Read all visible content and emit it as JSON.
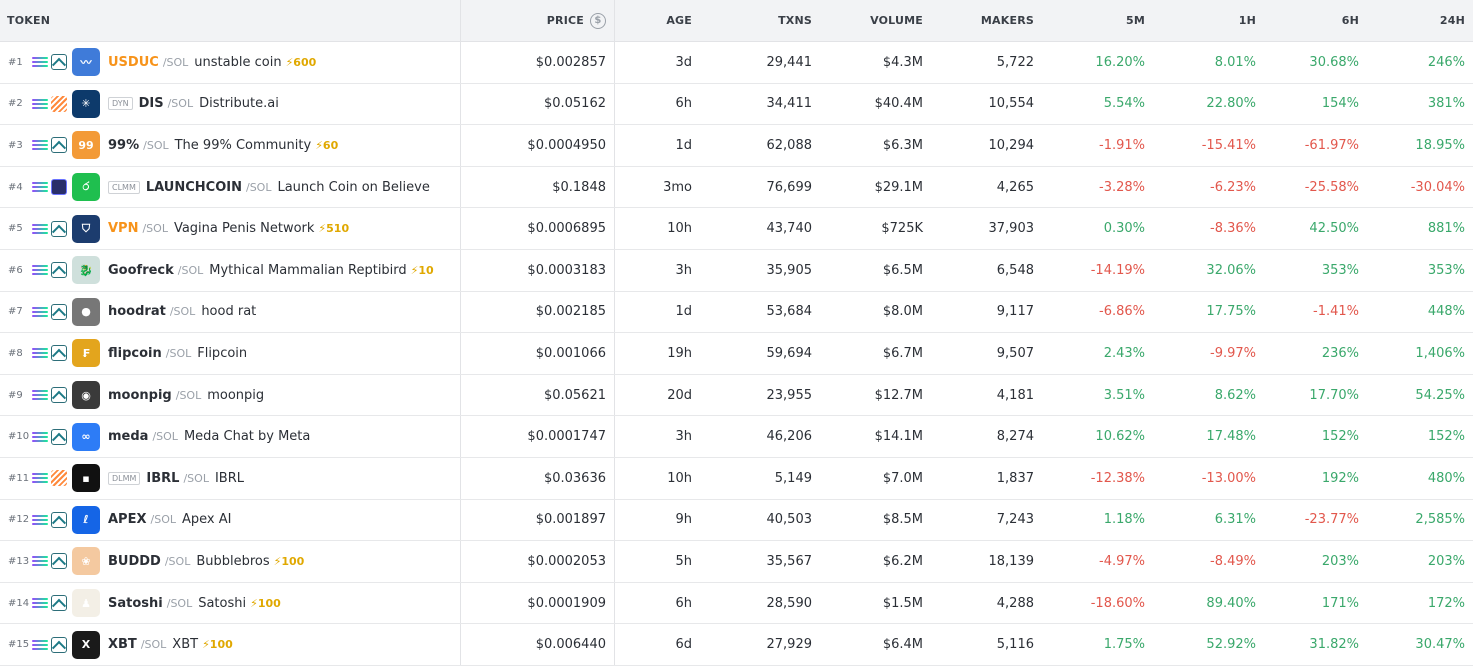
{
  "headers": {
    "token": "TOKEN",
    "price": "PRICE",
    "age": "AGE",
    "txns": "TXNS",
    "volume": "VOLUME",
    "makers": "MAKERS",
    "m5": "5M",
    "h1": "1H",
    "h6": "6H",
    "h24": "24H"
  },
  "rows": [
    {
      "rank": "#1",
      "badge": "",
      "symbol": "USDUC",
      "pair": "/SOL",
      "name": "unstable coin",
      "boost": "600",
      "price": "$0.002857",
      "age": "3d",
      "txns": "29,441",
      "volume": "$4.3M",
      "makers": "5,722",
      "m5": "16.20%",
      "h1": "8.01%",
      "h6": "30.68%",
      "h24": "246%",
      "dex": "ray",
      "logo_color": "#3f7bd9",
      "logo_glyph": "〰",
      "sym_color": "orange",
      "signs": [
        "pos",
        "pos",
        "pos",
        "pos"
      ]
    },
    {
      "rank": "#2",
      "badge": "DYN",
      "symbol": "DIS",
      "pair": "/SOL",
      "name": "Distribute.ai",
      "boost": "",
      "price": "$0.05162",
      "age": "6h",
      "txns": "34,411",
      "volume": "$40.4M",
      "makers": "10,554",
      "m5": "5.54%",
      "h1": "22.80%",
      "h6": "154%",
      "h24": "381%",
      "dex": "stripe",
      "logo_color": "#0d3a6b",
      "logo_glyph": "✳",
      "sym_color": "",
      "signs": [
        "pos",
        "pos",
        "pos",
        "pos"
      ]
    },
    {
      "rank": "#3",
      "badge": "",
      "symbol": "99%",
      "pair": "/SOL",
      "name": "The 99% Community",
      "boost": "60",
      "price": "$0.0004950",
      "age": "1d",
      "txns": "62,088",
      "volume": "$6.3M",
      "makers": "10,294",
      "m5": "-1.91%",
      "h1": "-15.41%",
      "h6": "-61.97%",
      "h24": "18.95%",
      "dex": "ray",
      "logo_color": "#f39a37",
      "logo_glyph": "99",
      "sym_color": "",
      "signs": [
        "neg",
        "neg",
        "neg",
        "pos"
      ]
    },
    {
      "rank": "#4",
      "badge": "CLMM",
      "symbol": "LAUNCHCOIN",
      "pair": "/SOL",
      "name": "Launch Coin on Believe",
      "boost": "",
      "price": "$0.1848",
      "age": "3mo",
      "txns": "76,699",
      "volume": "$29.1M",
      "makers": "4,265",
      "m5": "-3.28%",
      "h1": "-6.23%",
      "h6": "-25.58%",
      "h24": "-30.04%",
      "dex": "blk",
      "logo_color": "#1fbf4f",
      "logo_glyph": "ර",
      "sym_color": "",
      "signs": [
        "neg",
        "neg",
        "neg",
        "neg"
      ]
    },
    {
      "rank": "#5",
      "badge": "",
      "symbol": "VPN",
      "pair": "/SOL",
      "name": "Vagina Penis Network",
      "boost": "510",
      "price": "$0.0006895",
      "age": "10h",
      "txns": "43,740",
      "volume": "$725K",
      "makers": "37,903",
      "m5": "0.30%",
      "h1": "-8.36%",
      "h6": "42.50%",
      "h24": "881%",
      "dex": "ray",
      "logo_color": "#1c3c6e",
      "logo_glyph": "⛉",
      "sym_color": "orange",
      "signs": [
        "pos",
        "neg",
        "pos",
        "pos"
      ]
    },
    {
      "rank": "#6",
      "badge": "",
      "symbol": "Goofreck",
      "pair": "/SOL",
      "name": "Mythical Mammalian Reptibird",
      "boost": "10",
      "price": "$0.0003183",
      "age": "3h",
      "txns": "35,905",
      "volume": "$6.5M",
      "makers": "6,548",
      "m5": "-14.19%",
      "h1": "32.06%",
      "h6": "353%",
      "h24": "353%",
      "dex": "ray",
      "logo_color": "#cfe0dc",
      "logo_glyph": "🐉",
      "sym_color": "",
      "signs": [
        "neg",
        "pos",
        "pos",
        "pos"
      ]
    },
    {
      "rank": "#7",
      "badge": "",
      "symbol": "hoodrat",
      "pair": "/SOL",
      "name": "hood rat",
      "boost": "",
      "price": "$0.002185",
      "age": "1d",
      "txns": "53,684",
      "volume": "$8.0M",
      "makers": "9,117",
      "m5": "-6.86%",
      "h1": "17.75%",
      "h6": "-1.41%",
      "h24": "448%",
      "dex": "ray",
      "logo_color": "#777777",
      "logo_glyph": "●",
      "sym_color": "",
      "signs": [
        "neg",
        "pos",
        "neg",
        "pos"
      ]
    },
    {
      "rank": "#8",
      "badge": "",
      "symbol": "flipcoin",
      "pair": "/SOL",
      "name": "Flipcoin",
      "boost": "",
      "price": "$0.001066",
      "age": "19h",
      "txns": "59,694",
      "volume": "$6.7M",
      "makers": "9,507",
      "m5": "2.43%",
      "h1": "-9.97%",
      "h6": "236%",
      "h24": "1,406%",
      "dex": "ray",
      "logo_color": "#e3a51d",
      "logo_glyph": "₣",
      "sym_color": "",
      "signs": [
        "pos",
        "neg",
        "pos",
        "pos"
      ]
    },
    {
      "rank": "#9",
      "badge": "",
      "symbol": "moonpig",
      "pair": "/SOL",
      "name": "moonpig",
      "boost": "",
      "price": "$0.05621",
      "age": "20d",
      "txns": "23,955",
      "volume": "$12.7M",
      "makers": "4,181",
      "m5": "3.51%",
      "h1": "8.62%",
      "h6": "17.70%",
      "h24": "54.25%",
      "dex": "ray",
      "logo_color": "#3a3a3a",
      "logo_glyph": "◉",
      "sym_color": "",
      "signs": [
        "pos",
        "pos",
        "pos",
        "pos"
      ]
    },
    {
      "rank": "#10",
      "badge": "",
      "symbol": "meda",
      "pair": "/SOL",
      "name": "Meda Chat by Meta",
      "boost": "",
      "price": "$0.0001747",
      "age": "3h",
      "txns": "46,206",
      "volume": "$14.1M",
      "makers": "8,274",
      "m5": "10.62%",
      "h1": "17.48%",
      "h6": "152%",
      "h24": "152%",
      "dex": "ray",
      "logo_color": "#2d7cf6",
      "logo_glyph": "∞",
      "sym_color": "",
      "signs": [
        "pos",
        "pos",
        "pos",
        "pos"
      ]
    },
    {
      "rank": "#11",
      "badge": "DLMM",
      "symbol": "IBRL",
      "pair": "/SOL",
      "name": "IBRL",
      "boost": "",
      "price": "$0.03636",
      "age": "10h",
      "txns": "5,149",
      "volume": "$7.0M",
      "makers": "1,837",
      "m5": "-12.38%",
      "h1": "-13.00%",
      "h6": "192%",
      "h24": "480%",
      "dex": "stripe",
      "logo_color": "#111111",
      "logo_glyph": "▪",
      "sym_color": "",
      "signs": [
        "neg",
        "neg",
        "pos",
        "pos"
      ]
    },
    {
      "rank": "#12",
      "badge": "",
      "symbol": "APEX",
      "pair": "/SOL",
      "name": "Apex AI",
      "boost": "",
      "price": "$0.001897",
      "age": "9h",
      "txns": "40,503",
      "volume": "$8.5M",
      "makers": "7,243",
      "m5": "1.18%",
      "h1": "6.31%",
      "h6": "-23.77%",
      "h24": "2,585%",
      "dex": "ray",
      "logo_color": "#1565e6",
      "logo_glyph": "ℓ",
      "sym_color": "",
      "signs": [
        "pos",
        "pos",
        "neg",
        "pos"
      ]
    },
    {
      "rank": "#13",
      "badge": "",
      "symbol": "BUDDD",
      "pair": "/SOL",
      "name": "Bubblebros",
      "boost": "100",
      "price": "$0.0002053",
      "age": "5h",
      "txns": "35,567",
      "volume": "$6.2M",
      "makers": "18,139",
      "m5": "-4.97%",
      "h1": "-8.49%",
      "h6": "203%",
      "h24": "203%",
      "dex": "ray",
      "logo_color": "#f4c9a0",
      "logo_glyph": "❀",
      "sym_color": "",
      "signs": [
        "neg",
        "neg",
        "pos",
        "pos"
      ]
    },
    {
      "rank": "#14",
      "badge": "",
      "symbol": "Satoshi",
      "pair": "/SOL",
      "name": "Satoshi",
      "boost": "100",
      "price": "$0.0001909",
      "age": "6h",
      "txns": "28,590",
      "volume": "$1.5M",
      "makers": "4,288",
      "m5": "-18.60%",
      "h1": "89.40%",
      "h6": "171%",
      "h24": "172%",
      "dex": "ray",
      "logo_color": "#f3efe6",
      "logo_glyph": "♟",
      "sym_color": "",
      "signs": [
        "neg",
        "pos",
        "pos",
        "pos"
      ]
    },
    {
      "rank": "#15",
      "badge": "",
      "symbol": "XBT",
      "pair": "/SOL",
      "name": "XBT",
      "boost": "100",
      "price": "$0.006440",
      "age": "6d",
      "txns": "27,929",
      "volume": "$6.4M",
      "makers": "5,116",
      "m5": "1.75%",
      "h1": "52.92%",
      "h6": "31.82%",
      "h24": "30.47%",
      "dex": "ray",
      "logo_color": "#1a1a1a",
      "logo_glyph": "X",
      "sym_color": "",
      "signs": [
        "pos",
        "pos",
        "pos",
        "pos"
      ]
    }
  ],
  "colors": {
    "positive": "#3aa86b",
    "negative": "#e2574c",
    "boost": "#e0a800",
    "symbol_orange": "#f7931a"
  },
  "icons": {
    "price_header": "dollar-circle-icon",
    "chain": "solana-icon",
    "boost": "lightning-icon"
  }
}
